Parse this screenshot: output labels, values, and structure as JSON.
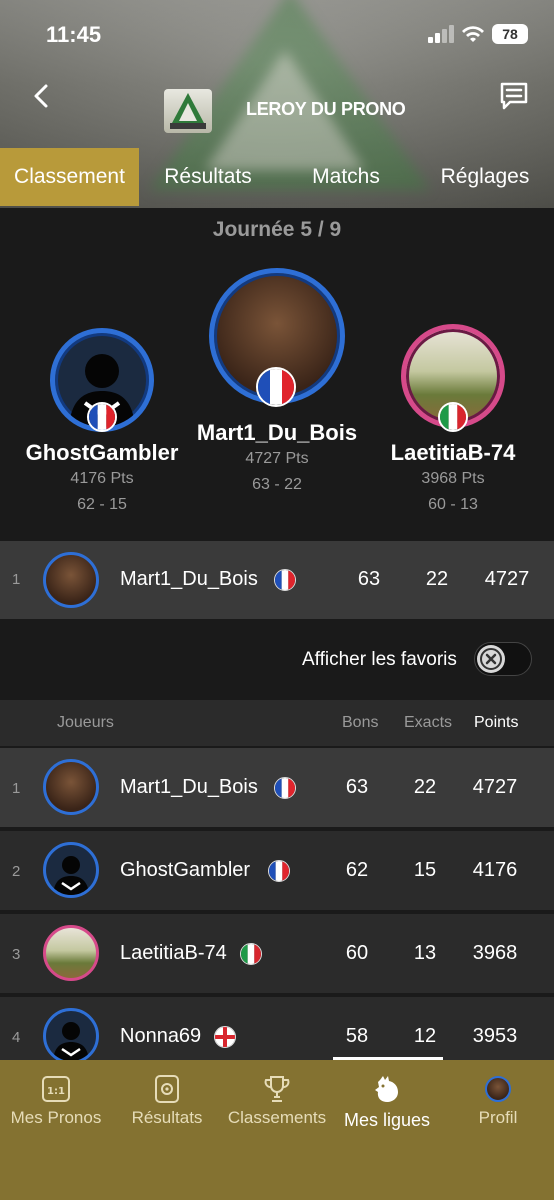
{
  "status_bar": {
    "time": "11:45",
    "battery": "78"
  },
  "header": {
    "league_title": "LEROY DU PRONO"
  },
  "tabs": [
    {
      "label": "Classement",
      "active": true
    },
    {
      "label": "Résultats",
      "active": false
    },
    {
      "label": "Matchs",
      "active": false
    },
    {
      "label": "Réglages",
      "active": false
    }
  ],
  "podium": {
    "round_label": "Journée 5 / 9",
    "first": {
      "name": "Mart1_Du_Bois",
      "points": "4727  Pts",
      "record": "63 - 22",
      "flag": "france"
    },
    "second": {
      "name": "GhostGambler",
      "points": "4176  Pts",
      "record": "62 - 15",
      "flag": "france"
    },
    "third": {
      "name": "LaetitiaB-74",
      "points": "3968  Pts",
      "record": "60 - 13",
      "flag": "italy"
    }
  },
  "my_row": {
    "rank": "1",
    "name": "Mart1_Du_Bois",
    "bons": "63",
    "exacts": "22",
    "points": "4727",
    "flag": "france"
  },
  "favorites": {
    "label": "Afficher les favoris",
    "enabled": false
  },
  "table": {
    "headers": {
      "players": "Joueurs",
      "bons": "Bons",
      "exacts": "Exacts",
      "points": "Points"
    },
    "rows": [
      {
        "rank": "1",
        "name": "Mart1_Du_Bois",
        "bons": "63",
        "exacts": "22",
        "points": "4727",
        "flag": "france",
        "highlight": true
      },
      {
        "rank": "2",
        "name": "GhostGambler",
        "bons": "62",
        "exacts": "15",
        "points": "4176",
        "flag": "france",
        "highlight": false
      },
      {
        "rank": "3",
        "name": "LaetitiaB-74",
        "bons": "60",
        "exacts": "13",
        "points": "3968",
        "flag": "italy",
        "highlight": false
      },
      {
        "rank": "4",
        "name": "Nonna69",
        "bons": "58",
        "exacts": "12",
        "points": "3953",
        "flag": "england",
        "highlight": false
      }
    ]
  },
  "bottom_nav": [
    {
      "label": "Mes Pronos",
      "icon": "score-1-1-icon",
      "active": false
    },
    {
      "label": "Résultats",
      "icon": "ball-card-icon",
      "active": false
    },
    {
      "label": "Classements",
      "icon": "trophy-icon",
      "active": false
    },
    {
      "label": "Mes ligues",
      "icon": "rooster-icon",
      "active": true
    },
    {
      "label": "Profil",
      "icon": "profile-avatar-icon",
      "active": false
    }
  ],
  "colors": {
    "accent": "#b89a3a",
    "nav_bg": "#847231",
    "ring_blue": "#2e6fd6",
    "ring_pink": "#d64a8a"
  }
}
